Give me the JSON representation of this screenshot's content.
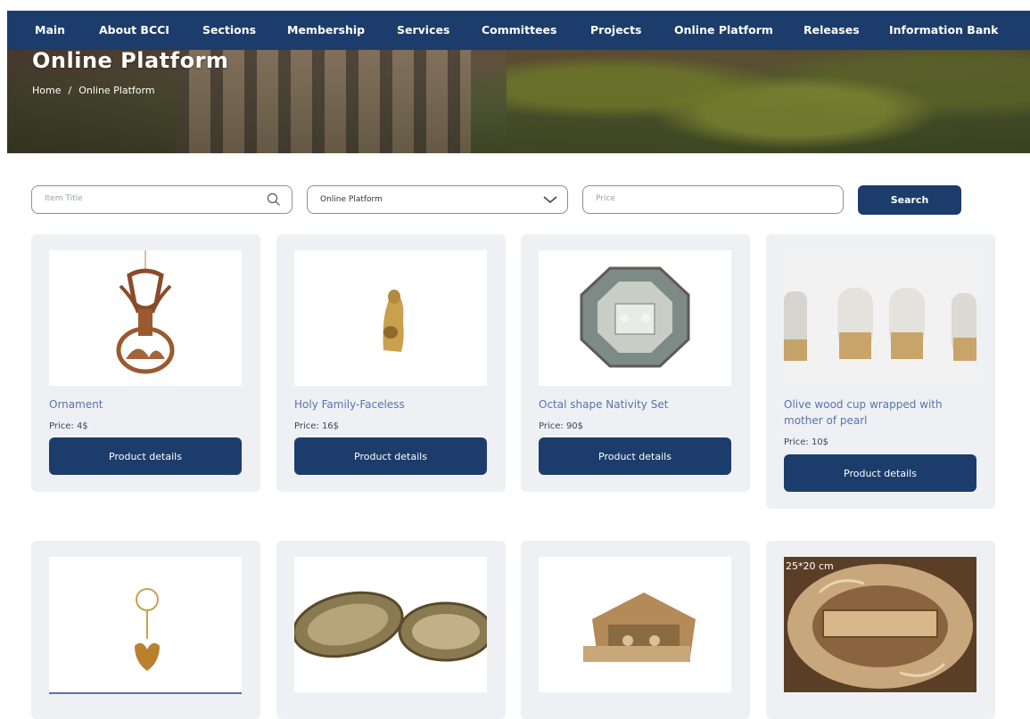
{
  "nav": {
    "items": [
      "Main",
      "About BCCI",
      "Sections",
      "Membership",
      "Services",
      "Committees",
      "Projects",
      "Online Platform",
      "Releases",
      "Information Bank"
    ]
  },
  "hero": {
    "title": "Online Platform",
    "breadcrumb": {
      "home": "Home",
      "separator": "/",
      "current": "Online Platform"
    }
  },
  "filters": {
    "title_placeholder": "Item Title",
    "category_selected": "Online Platform",
    "price_placeholder": "Price",
    "search_label": "Search"
  },
  "products": [
    {
      "title": "Ornament",
      "price": "Price: 4$",
      "button": "Product details"
    },
    {
      "title": "Holy Family-Faceless",
      "price": "Price: 16$",
      "button": "Product details"
    },
    {
      "title": "Octal shape Nativity Set",
      "price": "Price: 90$",
      "button": "Product details"
    },
    {
      "title": "Olive wood cup wrapped with mother of pearl",
      "price": "Price: 10$",
      "button": "Product details"
    },
    {
      "title": "",
      "price": "",
      "button": ""
    },
    {
      "title": "",
      "price": "",
      "button": ""
    },
    {
      "title": "",
      "price": "",
      "button": ""
    },
    {
      "title": "",
      "price": "",
      "button": "",
      "image_caption": "25*20 cm"
    }
  ],
  "colors": {
    "nav_bg": "#1c3c6b",
    "button_bg": "#1c3c6b",
    "card_bg": "#eef0f4",
    "title_link": "#5b73a8"
  }
}
